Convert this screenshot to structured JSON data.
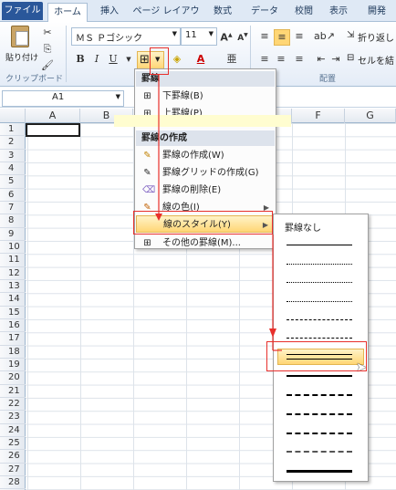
{
  "tabs": [
    "ファイル",
    "ホーム",
    "挿入",
    "ページ レイアウト",
    "数式",
    "データ",
    "校閲",
    "表示",
    "開発"
  ],
  "ribbon": {
    "paste_label": "貼り付け",
    "clipboard_group": "クリップボード",
    "font_name": "ＭＳ Ｐゴシック",
    "font_size": "11",
    "wrap_text": "折り返し",
    "merge_cells": "セルを結",
    "alignment_group": "配置"
  },
  "formula_bar": {
    "name_box": "A1"
  },
  "columns": [
    "A",
    "B",
    "C",
    "D",
    "E",
    "F",
    "G"
  ],
  "rows": [
    "1",
    "2",
    "3",
    "4",
    "5",
    "6",
    "7",
    "8",
    "9",
    "10",
    "11",
    "12",
    "13",
    "14",
    "15",
    "16",
    "17",
    "18",
    "19",
    "20",
    "21",
    "22",
    "23",
    "24",
    "25",
    "26",
    "27",
    "28"
  ],
  "menu": {
    "header_borders": "罫線",
    "bottom_border": "下罫線(B)",
    "top_border": "上罫線(P)",
    "header_draw": "罫線の作成",
    "draw_border": "罫線の作成(W)",
    "draw_grid": "罫線グリッドの作成(G)",
    "erase_border": "罫線の削除(E)",
    "line_color": "線の色(I)",
    "line_style": "線のスタイル(Y)",
    "more_borders": "その他の罫線(M)..."
  },
  "submenu": {
    "no_border": "罫線なし",
    "styles": [
      "thin",
      "hair",
      "dotted",
      "dash-dot-dot",
      "dash-dot",
      "dashed",
      "double",
      "thick",
      "medium-dashed",
      "medium-dash-dot",
      "medium-dash-dot-dot",
      "slant-dash-dot",
      "thick-solid"
    ]
  },
  "colors": {
    "accent_red": "#e8302c",
    "highlight": "#ffd675",
    "file_tab": "#2a579a"
  }
}
